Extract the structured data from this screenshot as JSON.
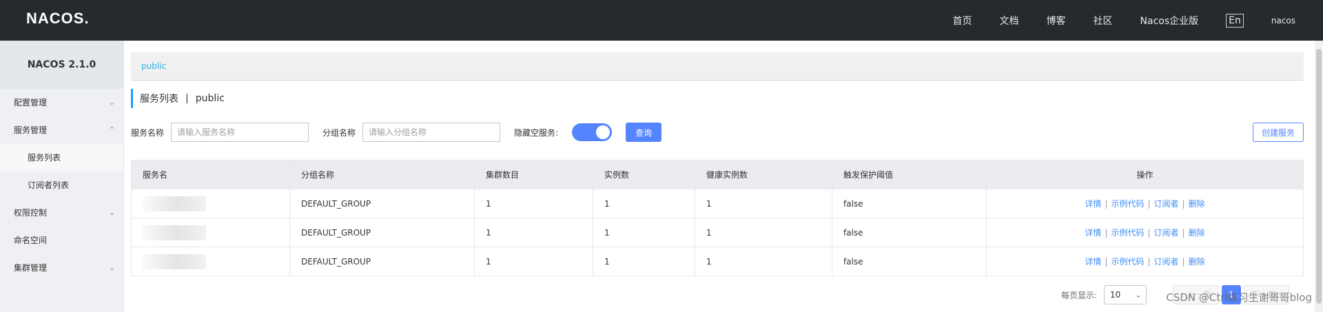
{
  "header": {
    "logo": "NACOS.",
    "nav": [
      "首页",
      "文档",
      "博客",
      "社区",
      "Nacos企业版"
    ],
    "lang": "En",
    "user": "nacos"
  },
  "sidebar": {
    "title": "NACOS 2.1.0",
    "items": [
      {
        "label": "配置管理",
        "type": "group",
        "expanded": false
      },
      {
        "label": "服务管理",
        "type": "group",
        "expanded": true
      },
      {
        "label": "服务列表",
        "type": "sub",
        "active": true
      },
      {
        "label": "订阅者列表",
        "type": "sub",
        "active": false
      },
      {
        "label": "权限控制",
        "type": "group",
        "expanded": false
      },
      {
        "label": "命名空间",
        "type": "item"
      },
      {
        "label": "集群管理",
        "type": "group",
        "expanded": false
      }
    ]
  },
  "main": {
    "namespace_tab": "public",
    "page_title": "服务列表",
    "page_title_sep": "|",
    "page_title_namespace": "public",
    "filters": {
      "service_name_label": "服务名称",
      "service_name_placeholder": "请输入服务名称",
      "group_name_label": "分组名称",
      "group_name_placeholder": "请输入分组名称",
      "hide_empty_label": "隐藏空服务:",
      "hide_empty_on": true,
      "query_button": "查询",
      "create_button": "创建服务"
    },
    "table": {
      "columns": [
        "服务名",
        "分组名称",
        "集群数目",
        "实例数",
        "健康实例数",
        "触发保护阈值",
        "操作"
      ],
      "rows": [
        {
          "group": "DEFAULT_GROUP",
          "clusters": "1",
          "instances": "1",
          "healthy": "1",
          "protect": "false"
        },
        {
          "group": "DEFAULT_GROUP",
          "clusters": "1",
          "instances": "1",
          "healthy": "1",
          "protect": "false"
        },
        {
          "group": "DEFAULT_GROUP",
          "clusters": "1",
          "instances": "1",
          "healthy": "1",
          "protect": "false"
        }
      ],
      "actions": [
        "详情",
        "示例代码",
        "订阅者",
        "删除"
      ]
    },
    "pagination": {
      "page_size_label": "每页显示:",
      "page_size": "10",
      "prev": "上一页",
      "current_page": "1",
      "next": "下一页"
    }
  },
  "watermark": "CSDN @Ctrl练习生谢哥哥blog",
  "colors": {
    "primary": "#5584ff",
    "header_bg": "#252a2f",
    "sidebar_bg": "#eef0f3",
    "link": "#3f8ef5"
  }
}
